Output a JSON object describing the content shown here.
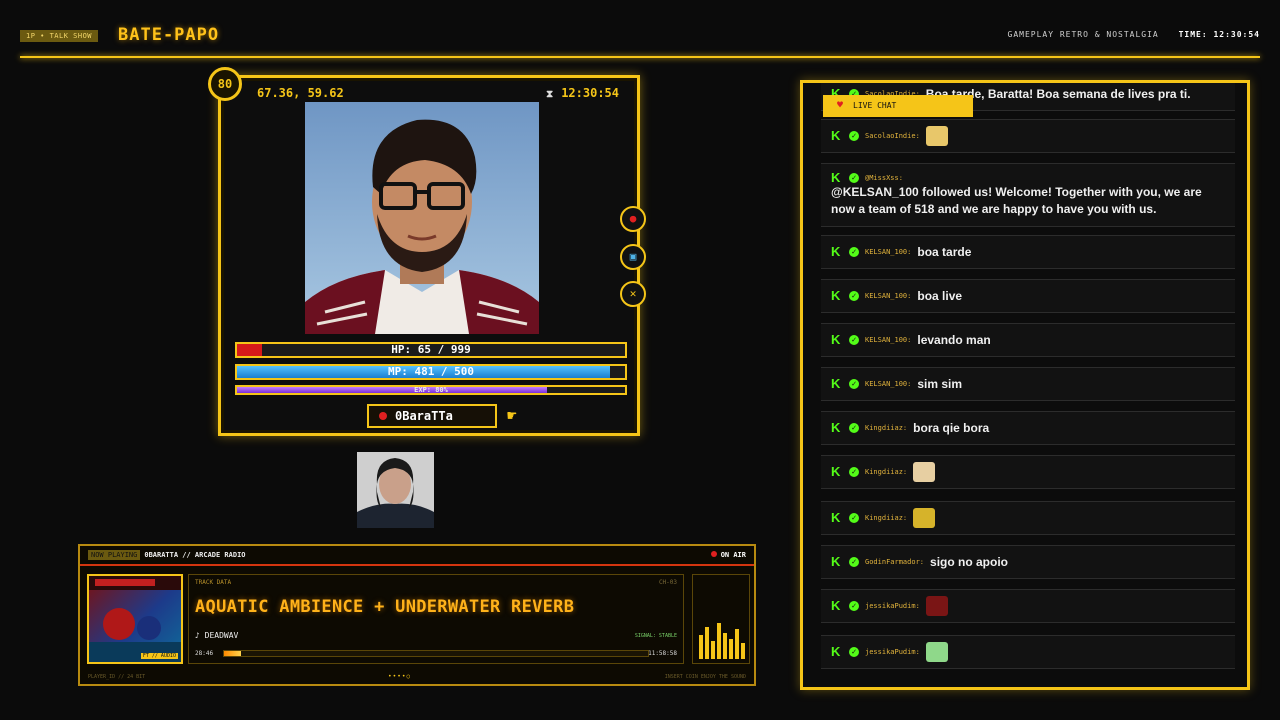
{
  "header": {
    "badge": "1P • TALK SHOW",
    "title": "BATE-PAPO",
    "subtitle": "GAMEPLAY RETRO & NOSTALGIA",
    "time_label": "TIME: 12:30:54"
  },
  "player": {
    "level": "80",
    "coords": "67.36, 59.62",
    "hourglass_icon": "hourglass-icon",
    "time": "12:30:54",
    "hp_label": "HP: 65 / 999",
    "hp_fraction": 0.065,
    "mp_label": "MP: 481 / 500",
    "mp_fraction": 0.962,
    "exp_label": "EXP: 80%",
    "exp_fraction": 0.8,
    "name": "0BaraTTa"
  },
  "side_buttons": [
    {
      "icon": "record-icon",
      "color": "#e02020"
    },
    {
      "icon": "screen-icon",
      "color": "#4fb3e6"
    },
    {
      "icon": "close-icon",
      "color": "#f5c518"
    }
  ],
  "now_playing": {
    "tag": "NOW PLAYING",
    "source": "0BARATTA // ARCADE RADIO",
    "on_air": "ON AIR",
    "track_data_label": "TRACK DATA",
    "channel": "CH-03",
    "title": "AQUATIC AMBIENCE + UNDERWATER REVERB",
    "artist": "♪ DEADWAV",
    "signal": "SIGNAL: STABLE",
    "time_elapsed": "28:46",
    "time_total": "11:58:58",
    "progress": 0.04,
    "cover_tag": "FT // AUDIO",
    "footer_left": "PLAYER_ID // 24 BIT",
    "footer_right": "INSERT COIN   ENJOY THE SOUND",
    "dots": "••••○"
  },
  "chat": {
    "tab_label": "LIVE CHAT",
    "messages": [
      {
        "user": "SacolaoIndie:",
        "text": "Boa tarde, Baratta! Boa semana de lives pra ti."
      },
      {
        "user": "SacolaoIndie:",
        "text": "",
        "emote": "#e8c76a"
      },
      {
        "user": "@MissXss:",
        "text": "@KELSAN_100 followed us! Welcome! Together with you, we are now a team of 518 and we are happy to have you with us."
      },
      {
        "user": "KELSAN_100:",
        "text": "boa tarde"
      },
      {
        "user": "KELSAN_100:",
        "text": "boa live"
      },
      {
        "user": "KELSAN_100:",
        "text": "levando man"
      },
      {
        "user": "KELSAN_100:",
        "text": "sim sim"
      },
      {
        "user": "Kingdiiaz:",
        "text": "bora qie bora"
      },
      {
        "user": "Kingdiiaz:",
        "text": "",
        "emote": "#e7cfa2"
      },
      {
        "user": "Kingdiiaz:",
        "text": "",
        "emote": "#d6b32a"
      },
      {
        "user": "GodinFarmador:",
        "text": "sigo no apoio"
      },
      {
        "user": "jessikaPudim:",
        "text": "",
        "emote": "#7a1515"
      },
      {
        "user": "jessikaPudim:",
        "text": "",
        "emote": "#8fd88a"
      }
    ]
  }
}
